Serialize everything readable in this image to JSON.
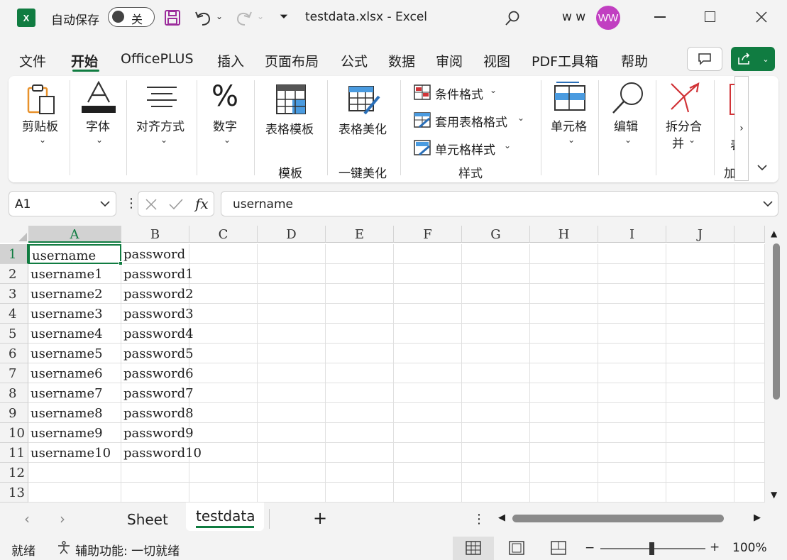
{
  "titlebar": {
    "autosave_label": "自动保存",
    "autosave_state": "关",
    "file_title": "testdata.xlsx  -  Excel",
    "user_name": "w w",
    "avatar_initials": "WW"
  },
  "menu": {
    "tabs": [
      "文件",
      "开始",
      "OfficePLUS",
      "插入",
      "页面布局",
      "公式",
      "数据",
      "审阅",
      "视图",
      "PDF工具箱",
      "帮助"
    ],
    "active_index": 1
  },
  "ribbon": {
    "clipboard": "剪贴板",
    "font": "字体",
    "align": "对齐方式",
    "number": "数字",
    "template": "表格模板",
    "beautify": "表格美化",
    "cond_format": "条件格式",
    "table_format": "套用表格格式",
    "cell_style": "单元格样式",
    "cells": "单元格",
    "edit": "编辑",
    "split_merge_1": "拆分合",
    "split_merge_2": "并",
    "partial_1": "表",
    "group_template": "模板",
    "group_beautify": "一键美化",
    "group_style": "样式",
    "group_partial": "加"
  },
  "formula_bar": {
    "name_box": "A1",
    "fx": "fx",
    "content": "username"
  },
  "grid": {
    "columns": [
      "A",
      "B",
      "C",
      "D",
      "E",
      "F",
      "G",
      "H",
      "I",
      "J"
    ],
    "rows": [
      {
        "n": "1",
        "a": "username",
        "b": "password"
      },
      {
        "n": "2",
        "a": "username1",
        "b": "password1"
      },
      {
        "n": "3",
        "a": "username2",
        "b": "password2"
      },
      {
        "n": "4",
        "a": "username3",
        "b": "password3"
      },
      {
        "n": "5",
        "a": "username4",
        "b": "password4"
      },
      {
        "n": "6",
        "a": "username5",
        "b": "password5"
      },
      {
        "n": "7",
        "a": "username6",
        "b": "password6"
      },
      {
        "n": "8",
        "a": "username7",
        "b": "password7"
      },
      {
        "n": "9",
        "a": "username8",
        "b": "password8"
      },
      {
        "n": "10",
        "a": "username9",
        "b": "password9"
      },
      {
        "n": "11",
        "a": "username10",
        "b": "password10"
      },
      {
        "n": "12",
        "a": "",
        "b": ""
      },
      {
        "n": "13",
        "a": "",
        "b": ""
      }
    ]
  },
  "sheets": {
    "tabs": [
      "Sheet",
      "testdata"
    ],
    "active": "testdata",
    "add": "+"
  },
  "statusbar": {
    "ready": "就绪",
    "accessibility": "辅助功能: 一切就绪",
    "zoom": "100%"
  },
  "colors": {
    "accent": "#107c41",
    "avatar": "#c13fc1"
  }
}
